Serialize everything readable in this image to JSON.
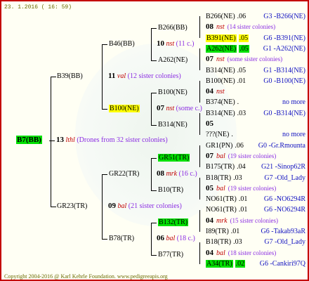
{
  "header": {
    "date": "23.  1.2016 ( 16: 59)"
  },
  "footer": {
    "copyright": "Copyright 2004-2016 @ Karl Kehrle Foundation.   www.pedigreeapis.org"
  },
  "root": {
    "name": "B7(BB)",
    "num": "13",
    "mark": "lthl",
    "desc": "(Drones from 32 sister colonies)"
  },
  "p": {
    "name": "B39(BB)",
    "num": "11",
    "mark": "val",
    "desc": "(12 sister colonies)",
    "pp": {
      "name": "B46(BB)",
      "num": "10",
      "mark": "nst",
      "desc": "(11 c.)",
      "ppp": {
        "name": "B266(BB)"
      },
      "ppm": {
        "name": "A262(NE)"
      }
    },
    "pm": {
      "name": "B100(NE)",
      "num": "07",
      "mark": "nst",
      "desc": "(some c.)",
      "pmp": {
        "name": "B100(NE)"
      },
      "pmm": {
        "name": "B314(NE)"
      }
    }
  },
  "m": {
    "name": "GR23(TR)",
    "num": "09",
    "mark": "bal",
    "desc": "(21 sister colonies)",
    "mp": {
      "name": "GR22(TR)",
      "num": "08",
      "mark": "mrk",
      "desc": "(16 c.)",
      "mpp": {
        "name": "GR51(TR)"
      },
      "mpm": {
        "name": "B10(TR)"
      }
    },
    "mm": {
      "name": "B78(TR)",
      "num": "06",
      "mark": "bal",
      "desc": "(18 c.)",
      "mmp": {
        "name": "B132(TR)"
      },
      "mmm": {
        "name": "B77(TR)"
      }
    }
  },
  "right_rows": [
    {
      "name": "B266(NE)",
      "yr": ".06",
      "code": "G3 -B266(NE)"
    },
    {
      "num": "08",
      "mark": "nst",
      "desc": "(14 sister colonies)"
    },
    {
      "name": "B391(NE)",
      "yr": ".05",
      "code": "G6 -B391(NE)"
    },
    {
      "name": "A262(NE)",
      "yr": ".05",
      "code": "G1 -A262(NE)"
    },
    {
      "num": "07",
      "mark": "nst",
      "desc": "(some sister colonies)"
    },
    {
      "name": "B314(NE)",
      "yr": ".05",
      "code": "G1 -B314(NE)"
    },
    {
      "name": "B100(NE)",
      "yr": ".01",
      "code": "G0 -B100(NE)"
    },
    {
      "num": "04",
      "mark": "nst",
      "desc": ""
    },
    {
      "name": "B374(NE)",
      "yr": ".",
      "code": "no more"
    },
    {
      "name": "B314(NE)",
      "yr": ".03",
      "code": "G0 -B314(NE)"
    },
    {
      "num": "05",
      "mark": "",
      "desc": ""
    },
    {
      "name": "???(NE)",
      "yr": ".",
      "code": "no more"
    },
    {
      "name": "GR1(PN)",
      "yr": ".06",
      "code": "G0 -Gr.Rmounta"
    },
    {
      "num": "07",
      "mark": "bal",
      "desc": "(19 sister colonies)"
    },
    {
      "name": "B175(TR)",
      "yr": ".04",
      "code": "G21 -Sinop62R"
    },
    {
      "name": "B18(TR)",
      "yr": ".03",
      "code": "G7 -Old_Lady"
    },
    {
      "num": "05",
      "mark": "bal",
      "desc": "(19 sister colonies)"
    },
    {
      "name": "NO61(TR)",
      "yr": ".01",
      "code": "G6 -NO6294R"
    },
    {
      "name": "NO61(TR)",
      "yr": ".01",
      "code": "G6 -NO6294R"
    },
    {
      "num": "04",
      "mark": "mrk",
      "desc": "(15 sister colonies)"
    },
    {
      "name": "I89(TR)",
      "yr": ".01",
      "code": "G6 -Takab93aR"
    },
    {
      "name": "B18(TR)",
      "yr": ".03",
      "code": "G7 -Old_Lady"
    },
    {
      "num": "04",
      "mark": "bal",
      "desc": "(18 sister colonies)"
    },
    {
      "name": "A34(TR)",
      "yr": ".02",
      "code": "G6 -Cankiri97Q"
    }
  ],
  "colors": {
    "border": "#c40000",
    "name_highlight_green": "#00e000",
    "name_highlight_yellow": "#ffff00",
    "blue_text": "#1010c0",
    "mark_red": "#c00000"
  }
}
